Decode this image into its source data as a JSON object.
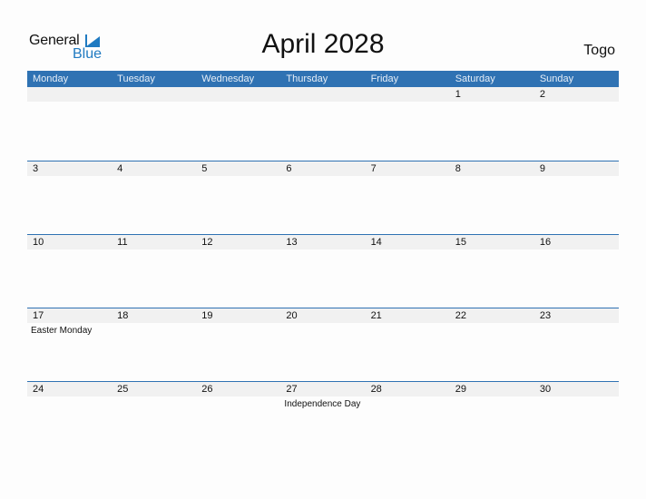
{
  "logo": {
    "general": "General",
    "blue": "Blue",
    "accent": "#1f7ac1"
  },
  "title": "April 2028",
  "country": "Togo",
  "header_color": "#2f72b3",
  "weekdays": [
    "Monday",
    "Tuesday",
    "Wednesday",
    "Thursday",
    "Friday",
    "Saturday",
    "Sunday"
  ],
  "weeks": [
    {
      "days": [
        "",
        "",
        "",
        "",
        "",
        "1",
        "2"
      ],
      "events": [
        "",
        "",
        "",
        "",
        "",
        "",
        ""
      ]
    },
    {
      "days": [
        "3",
        "4",
        "5",
        "6",
        "7",
        "8",
        "9"
      ],
      "events": [
        "",
        "",
        "",
        "",
        "",
        "",
        ""
      ]
    },
    {
      "days": [
        "10",
        "11",
        "12",
        "13",
        "14",
        "15",
        "16"
      ],
      "events": [
        "",
        "",
        "",
        "",
        "",
        "",
        ""
      ]
    },
    {
      "days": [
        "17",
        "18",
        "19",
        "20",
        "21",
        "22",
        "23"
      ],
      "events": [
        "Easter Monday",
        "",
        "",
        "",
        "",
        "",
        ""
      ]
    },
    {
      "days": [
        "24",
        "25",
        "26",
        "27",
        "28",
        "29",
        "30"
      ],
      "events": [
        "",
        "",
        "",
        "Independence Day",
        "",
        "",
        ""
      ]
    }
  ]
}
